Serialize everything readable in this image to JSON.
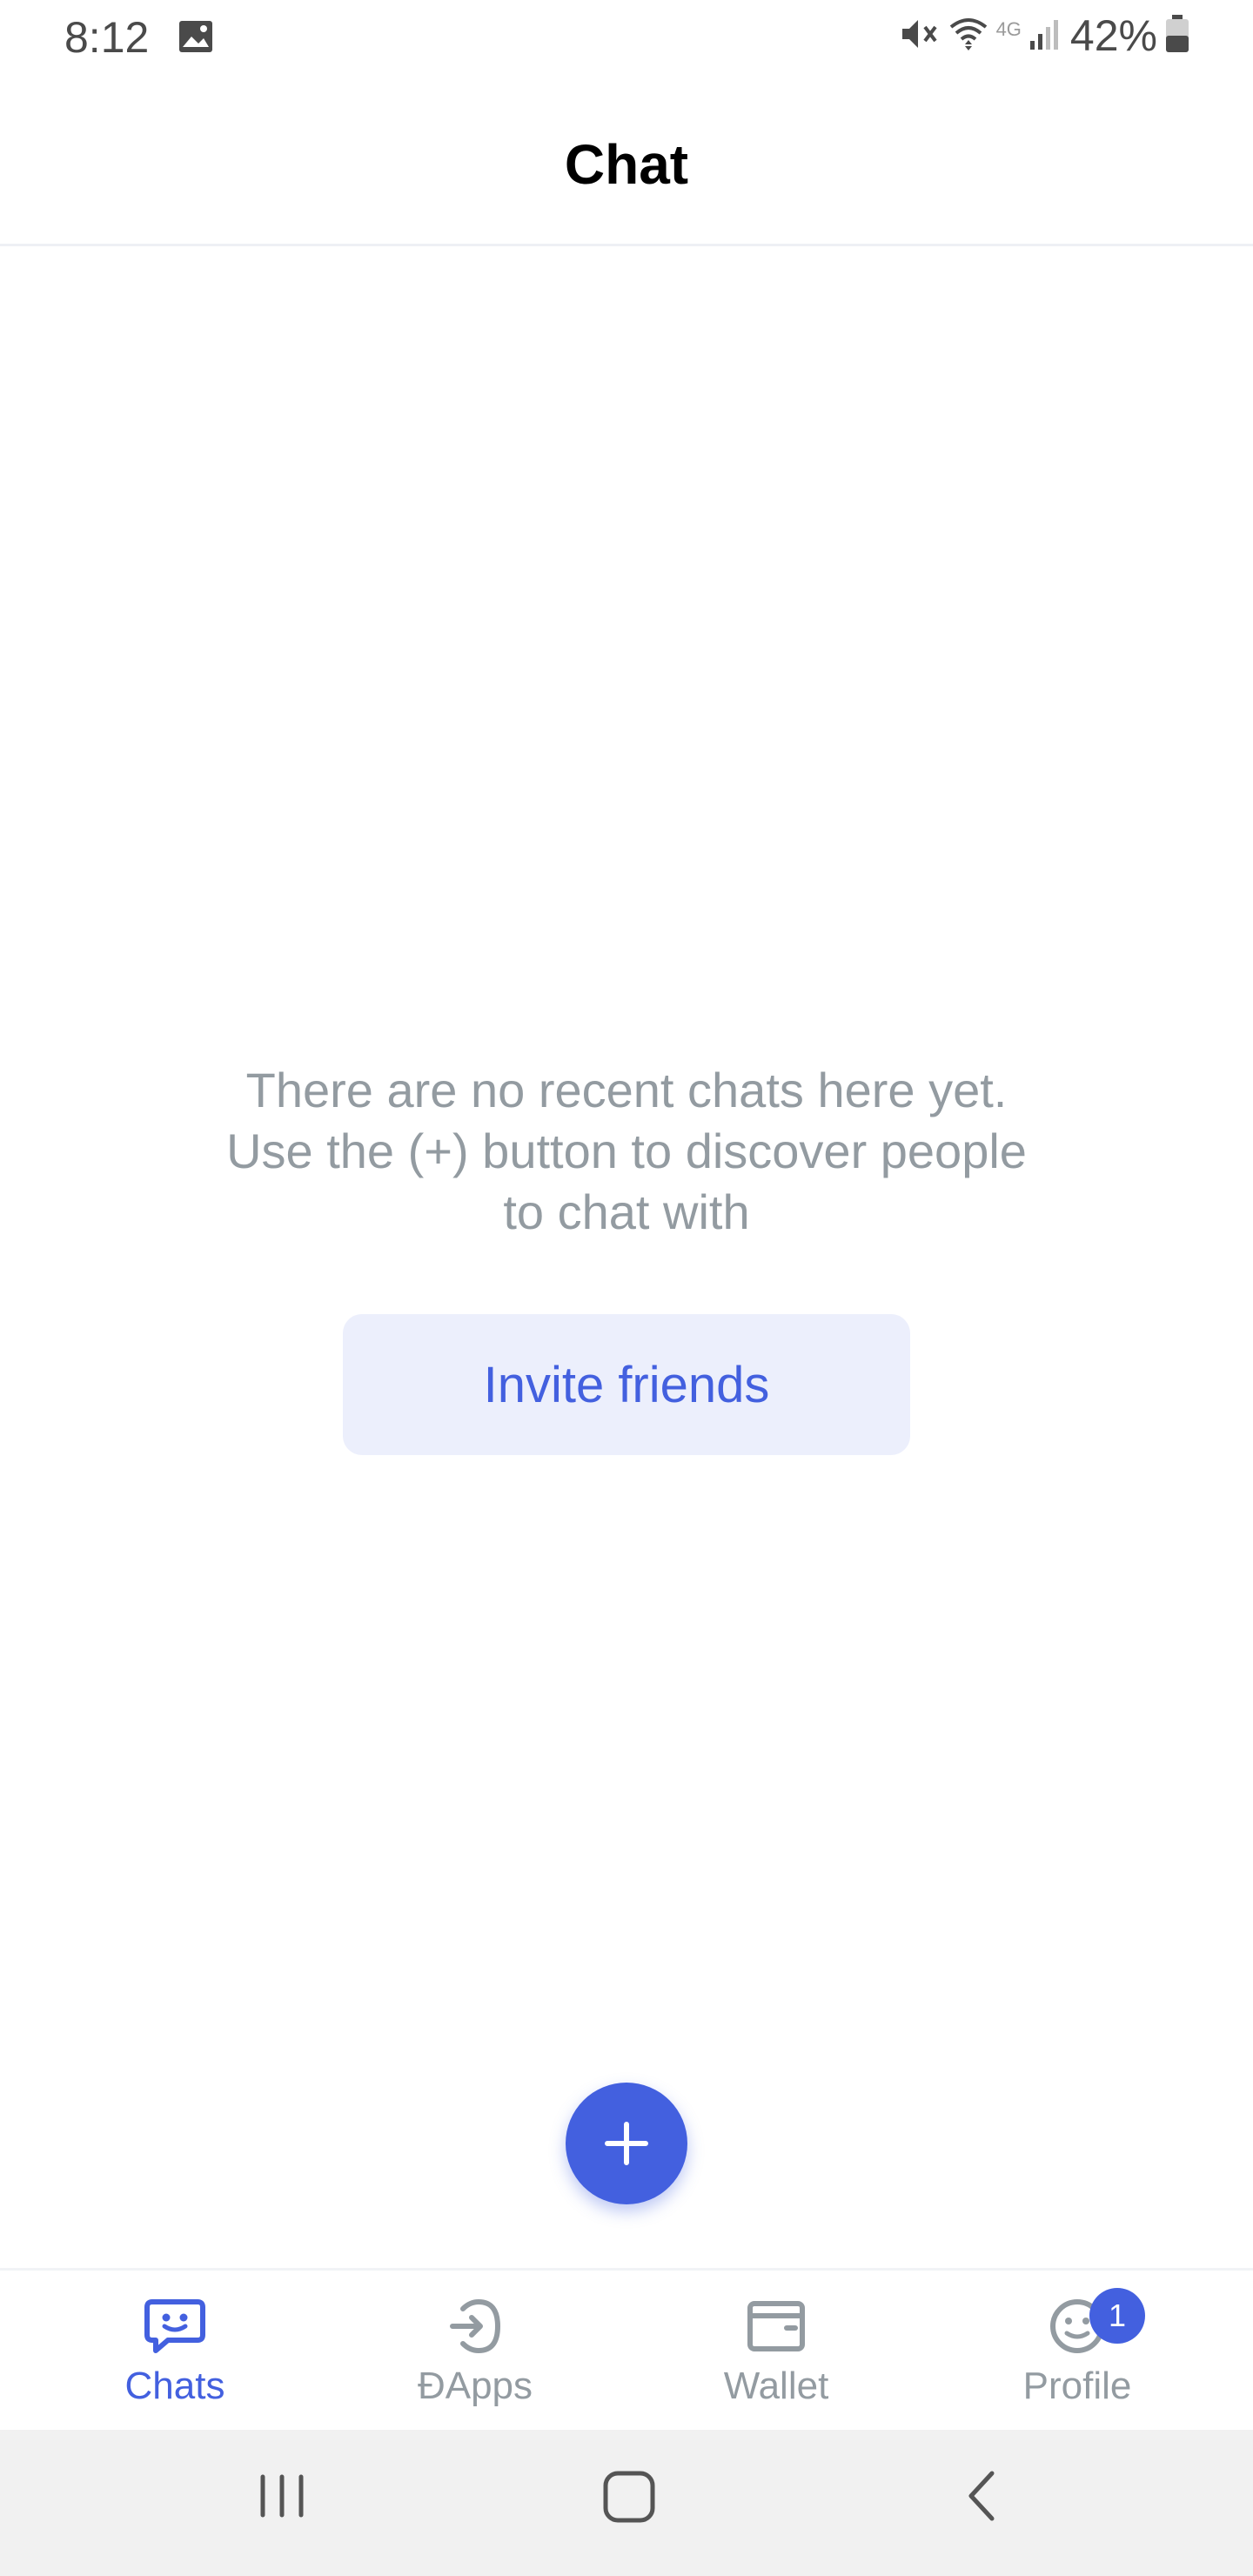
{
  "status_bar": {
    "time": "8:12",
    "battery": "42%",
    "icons": [
      "gallery-icon",
      "mute-icon",
      "wifi-icon",
      "4g-icon",
      "signal-icon",
      "battery-icon"
    ]
  },
  "header": {
    "title": "Chat"
  },
  "empty_state": {
    "lines": [
      "There are no recent chats here yet.",
      "Use the (+) button to discover people",
      "to chat with"
    ],
    "button_label": "Invite friends"
  },
  "fab": {
    "icon": "plus-icon"
  },
  "tabs": [
    {
      "label": "Chats",
      "icon": "chat-bubble-icon",
      "active": true
    },
    {
      "label": "ÐApps",
      "icon": "dapps-icon",
      "active": false
    },
    {
      "label": "Wallet",
      "icon": "wallet-icon",
      "active": false
    },
    {
      "label": "Profile",
      "icon": "profile-icon",
      "active": false,
      "badge": "1"
    }
  ],
  "colors": {
    "accent": "#4360df",
    "accent_light": "#eceffc",
    "muted_text": "#939ba1"
  }
}
